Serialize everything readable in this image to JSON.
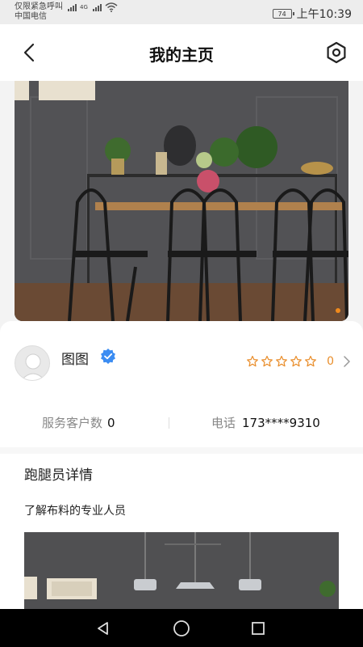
{
  "status_bar": {
    "line1": "仅限紧急呼叫",
    "line2": "中国电信",
    "network": "4G",
    "battery": "74",
    "time": "上午10:39"
  },
  "header": {
    "title": "我的主页",
    "back_icon": "chevron-left-icon",
    "settings_icon": "gear-icon"
  },
  "profile": {
    "name": "图图",
    "rating_count": "0",
    "stars": 0,
    "customers_label": "服务客户数",
    "customers_value": "0",
    "phone_label": "电话",
    "phone_value": "173****9310"
  },
  "details": {
    "title": "跑腿员详情",
    "description": "了解布料的专业人员"
  },
  "colors": {
    "accent": "#f08a1c",
    "verified": "#3b8cf2",
    "star": "#e98d2a"
  }
}
